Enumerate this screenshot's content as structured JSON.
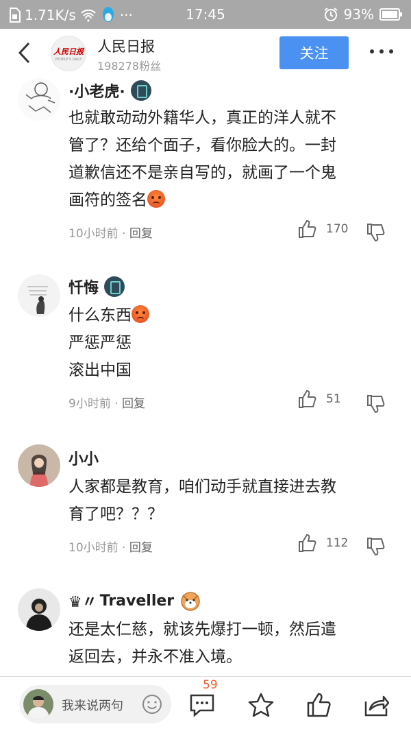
{
  "status_bar": {
    "speed": "1.71K/s",
    "time": "17:45",
    "battery": "93%"
  },
  "header": {
    "account_name": "人民日报",
    "logo_text": "人民日报",
    "logo_sub": "PEOPLE'S DAILY",
    "followers": "198278粉丝",
    "follow_label": "关注"
  },
  "comments": [
    {
      "username": "·小老虎·",
      "has_badge": true,
      "lines": [
        "也就敢动动外籍华人，真正的洋人就不",
        "管了？还给个面子，看你脸大的。一封",
        "道歉信还不是亲自写的，就画了一个鬼",
        "画符的签名"
      ],
      "time": "10小时前",
      "reply_label": "回复",
      "likes": "170"
    },
    {
      "username": "忏悔",
      "has_badge": true,
      "lines": [
        "什么东西",
        "严惩严惩",
        "滚出中国"
      ],
      "time": "9小时前",
      "reply_label": "回复",
      "likes": "51"
    },
    {
      "username": "小小",
      "has_badge": false,
      "lines": [
        "人家都是教育，咱们动手就直接进去教",
        "育了吧？？？"
      ],
      "time": "10小时前",
      "reply_label": "回复",
      "likes": "112"
    },
    {
      "username": "Traveller",
      "username_prefix": "♛〃",
      "has_badge": false,
      "lines": [
        "还是太仁慈，就该先爆打一顿，然后遣",
        "返回去，并永不准入境。"
      ]
    }
  ],
  "bottom_bar": {
    "input_placeholder": "我来说两句",
    "comment_count": "59"
  },
  "colors": {
    "accent": "#4b91f1",
    "status_bar": "#a8a8a8",
    "badge_count": "#f25a29"
  }
}
